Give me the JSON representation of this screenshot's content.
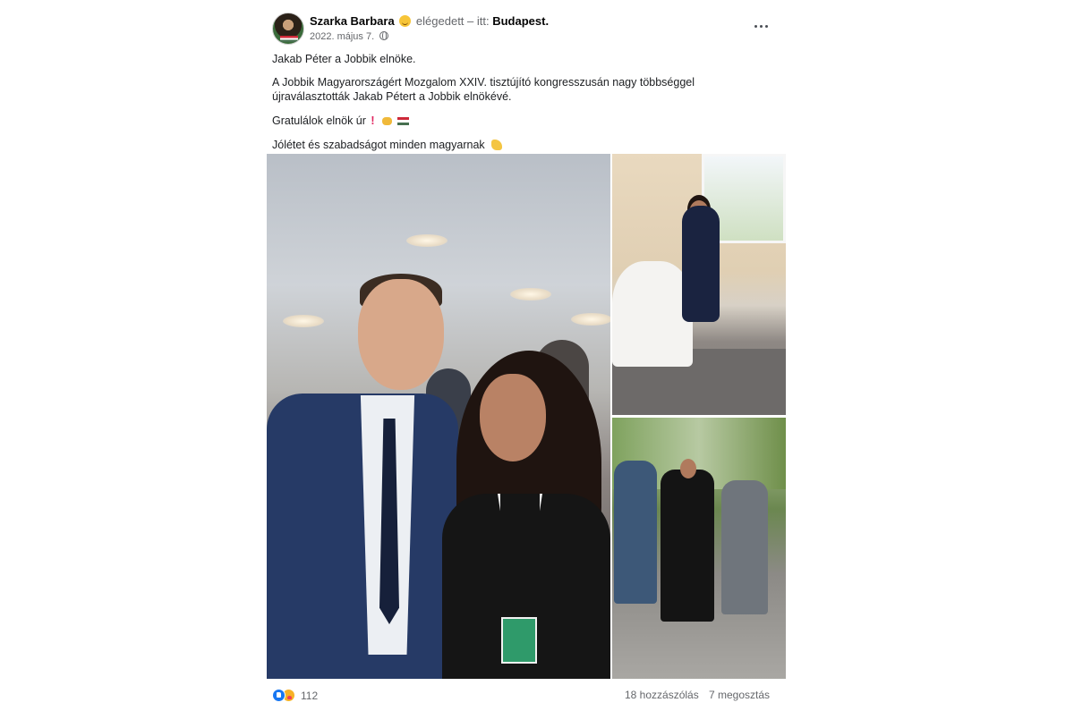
{
  "post": {
    "author": "Szarka Barbara",
    "feeling_icon": "smiling-face-emoji",
    "feeling_text": "elégedett – itt:",
    "location": "Budapest.",
    "date": "2022. május 7.",
    "audience_icon": "globe-icon",
    "lines": {
      "line1": "Jakab Péter a Jobbik elnöke.",
      "line2a": "A Jobbik Magyarországért Mozgalom XXIV. tisztújító kongresszusán nagy többséggel",
      "line2b": "újraválasztották Jakab Pétert a Jobbik elnökévé.",
      "line3": "Gratulálok elnök úr",
      "line4": "Jólétet  és szabadságot minden magyarnak"
    }
  },
  "reactions": {
    "count": "112",
    "icons": [
      "like-icon",
      "care-icon"
    ]
  },
  "footer": {
    "comments": "18 hozzászólás",
    "shares": "7 megosztás"
  },
  "colors": {
    "like_blue": "#1877f2",
    "meta_gray": "#65676b",
    "flag_red": "#ce2939",
    "flag_green": "#477050"
  }
}
